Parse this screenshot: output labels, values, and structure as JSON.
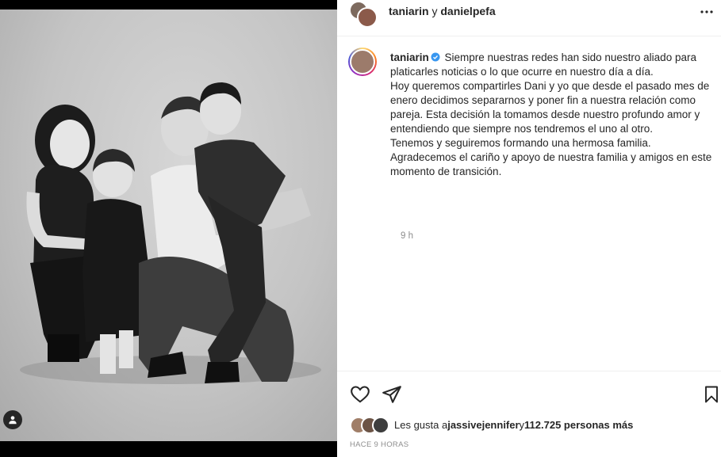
{
  "header": {
    "user1": "taniarin",
    "joiner": " y ",
    "user2": "danielpefa"
  },
  "caption": {
    "username": "taniarin",
    "text": "Siempre nuestras redes han sido nuestro aliado para platicarles noticias o lo que ocurre en nuestro día a día.\nHoy queremos compartirles Dani y yo que desde el pasado mes de enero decidimos separarnos y poner fin a nuestra relación como pareja. Esta decisión la tomamos desde nuestro profundo amor y entendiendo que siempre nos tendremos el uno al otro.\nTenemos y seguiremos formando una hermosa familia.\nAgradecemos el cariño y apoyo de nuestra familia y amigos en este momento de transición.",
    "time": "9 h"
  },
  "likes": {
    "prefix": "Les gusta a ",
    "user": "jassivejennifer",
    "joiner": " y ",
    "count": "112.725 personas más"
  },
  "posted": "HACE 9 HORAS",
  "icons": {
    "header_more": "more-horizontal-icon",
    "like": "heart-icon",
    "share": "paper-plane-icon",
    "save": "bookmark-icon",
    "tag": "user-tag-icon",
    "verified": "verified-badge-icon"
  },
  "colors": {
    "verified": "#3897f0",
    "muted": "#8e8e8e",
    "text": "#262626"
  }
}
